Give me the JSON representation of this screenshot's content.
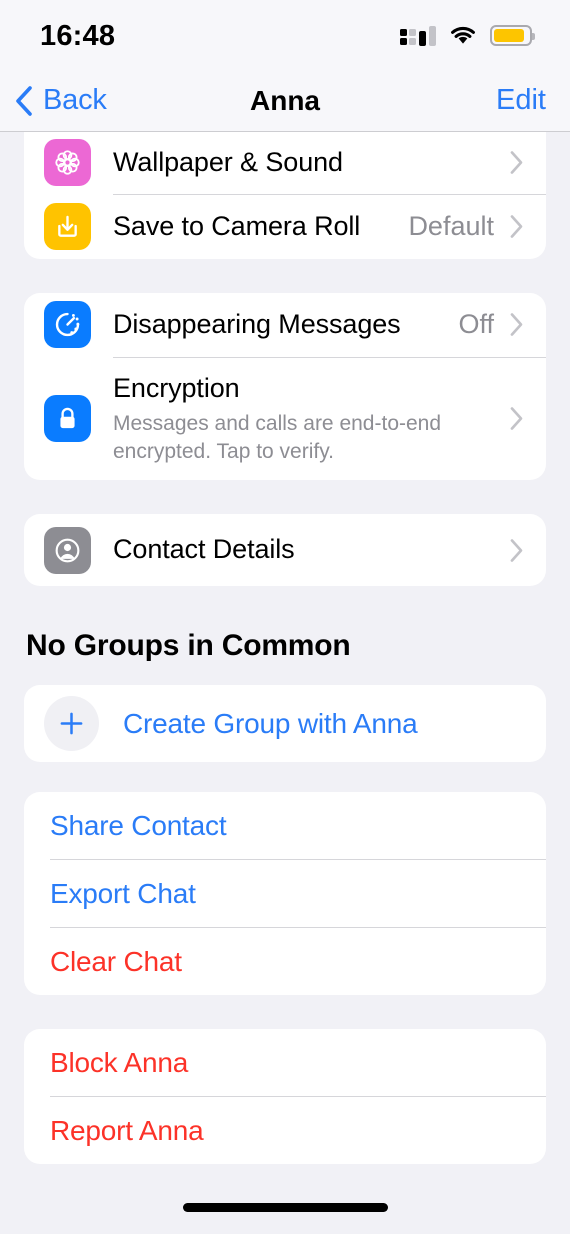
{
  "status_bar": {
    "time": "16:48",
    "cellular_icon": "cellular-signal-icon",
    "wifi_icon": "wifi-icon",
    "battery_icon": "battery-icon"
  },
  "nav_bar": {
    "back_label": "Back",
    "back_icon": "chevron-left-icon",
    "title": "Anna",
    "edit_label": "Edit"
  },
  "settings_group_1": {
    "rows": [
      {
        "label": "Wallpaper & Sound",
        "value": "",
        "icon": "wallpaper-flower-icon",
        "icon_color": "#ec68d4",
        "chevron": "chevron-right-icon"
      },
      {
        "label": "Save to Camera Roll",
        "value": "Default",
        "icon": "save-download-icon",
        "icon_color": "#ffc300",
        "chevron": "chevron-right-icon"
      }
    ]
  },
  "settings_group_2": {
    "rows": [
      {
        "label": "Disappearing Messages",
        "value": "Off",
        "sub": "",
        "icon": "timer-icon",
        "icon_color": "#0a7cff",
        "chevron": "chevron-right-icon"
      },
      {
        "label": "Encryption",
        "value": "",
        "sub": "Messages and calls are end-to-end encrypted. Tap to verify.",
        "icon": "lock-icon",
        "icon_color": "#0a7cff",
        "chevron": "chevron-right-icon"
      }
    ]
  },
  "settings_group_3": {
    "rows": [
      {
        "label": "Contact Details",
        "value": "",
        "icon": "contact-person-icon",
        "icon_color": "#8d8d93",
        "chevron": "chevron-right-icon"
      }
    ]
  },
  "groups_section": {
    "header": "No Groups in Common",
    "create_group_label": "Create Group with Anna",
    "plus_icon": "plus-icon"
  },
  "actions_group": {
    "items": [
      {
        "label": "Share Contact",
        "style": "blue"
      },
      {
        "label": "Export Chat",
        "style": "blue"
      },
      {
        "label": "Clear Chat",
        "style": "red"
      }
    ]
  },
  "danger_group": {
    "items": [
      {
        "label": "Block Anna",
        "style": "red"
      },
      {
        "label": "Report Anna",
        "style": "red"
      }
    ]
  },
  "home_indicator": {
    "name": "home-indicator"
  },
  "colors": {
    "accent_blue": "#2a7cf7",
    "destructive_red": "#fc3228",
    "page_background": "#f1f1f6",
    "card_background": "#ffffff",
    "secondary_text": "#8d8d93"
  }
}
